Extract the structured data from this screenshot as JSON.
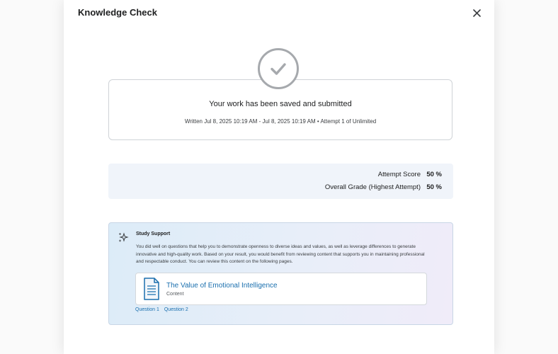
{
  "dialog": {
    "title": "Knowledge Check",
    "close_icon": "close-icon"
  },
  "submission": {
    "status_icon": "check-circle-icon",
    "title": "Your work has been saved and submitted",
    "meta": "Written Jul 8, 2025 10:19 AM - Jul 8, 2025 10:19 AM  •  Attempt 1 of Unlimited"
  },
  "scores": {
    "attempt_label": "Attempt Score",
    "attempt_value": "50 %",
    "overall_label": "Overall Grade (Highest Attempt)",
    "overall_value": "50 %"
  },
  "study_support": {
    "icon": "sparkle-icon",
    "heading": "Study Support",
    "text": "You did well on questions that help you to demonstrate openness to diverse ideas and values, as well as leverage differences to generate innovative and high-quality work. Based on your result, you would benefit from reviewing content that supports you in maintaining professional and respectable conduct. You can review this content on the following pages.",
    "content": {
      "icon": "document-icon",
      "title": "The Value of Emotional Intelligence",
      "type": "Content"
    },
    "questions": [
      "Question 1",
      "Question 2"
    ]
  },
  "colors": {
    "link": "#1a6fae",
    "score_bg": "#f0f4fa",
    "check": "#a6a9ad"
  }
}
